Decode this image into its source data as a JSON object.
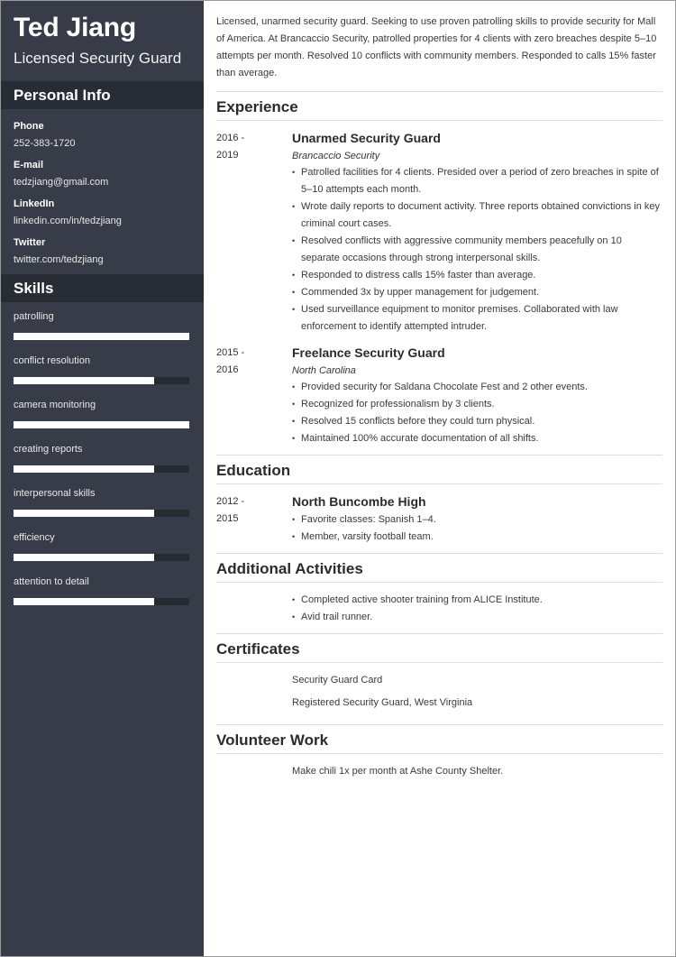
{
  "header": {
    "name": "Ted Jiang",
    "role": "Licensed Security Guard"
  },
  "personal_info": {
    "heading": "Personal Info",
    "items": [
      {
        "label": "Phone",
        "value": "252-383-1720"
      },
      {
        "label": "E-mail",
        "value": "tedzjiang@gmail.com"
      },
      {
        "label": "LinkedIn",
        "value": "linkedin.com/in/tedzjiang"
      },
      {
        "label": "Twitter",
        "value": "twitter.com/tedzjiang"
      }
    ]
  },
  "skills": {
    "heading": "Skills",
    "items": [
      {
        "label": "patrolling",
        "level": 1.0
      },
      {
        "label": "conflict resolution",
        "level": 0.8
      },
      {
        "label": "camera monitoring",
        "level": 1.0
      },
      {
        "label": "creating reports",
        "level": 0.8
      },
      {
        "label": "interpersonal skills",
        "level": 0.8
      },
      {
        "label": "efficiency",
        "level": 0.8
      },
      {
        "label": "attention to detail",
        "level": 0.8
      }
    ]
  },
  "summary": "Licensed, unarmed security guard. Seeking to use proven patrolling skills to provide security for Mall of America. At Brancaccio Security, patrolled properties for 4 clients with zero breaches despite 5–10 attempts per month. Resolved 10 conflicts with community members. Responded to calls 15% faster than average.",
  "experience": {
    "heading": "Experience",
    "entries": [
      {
        "date_start": "2016 -",
        "date_end": "2019",
        "title": "Unarmed Security Guard",
        "subtitle": "Brancaccio Security",
        "bullets": [
          "Patrolled facilities for 4 clients. Presided over a period of zero breaches in spite of 5–10 attempts each month.",
          "Wrote daily reports to document activity. Three reports obtained convictions in key criminal court cases.",
          "Resolved conflicts with aggressive community members peacefully on 10 separate occasions through strong interpersonal skills.",
          "Responded to distress calls 15% faster than average.",
          "Commended 3x by upper management for judgement.",
          "Used surveillance equipment to monitor premises. Collaborated with law enforcement to identify attempted intruder."
        ]
      },
      {
        "date_start": "2015 -",
        "date_end": "2016",
        "title": "Freelance Security Guard",
        "subtitle": "North Carolina",
        "bullets": [
          "Provided security for Saldana Chocolate Fest and 2 other events.",
          "Recognized for professionalism by 3 clients.",
          "Resolved 15 conflicts before they could turn physical.",
          "Maintained 100% accurate documentation of all shifts."
        ]
      }
    ]
  },
  "education": {
    "heading": "Education",
    "entries": [
      {
        "date_start": "2012 -",
        "date_end": "2015",
        "title": "North Buncombe High",
        "bullets": [
          "Favorite classes: Spanish 1–4.",
          "Member, varsity football team."
        ]
      }
    ]
  },
  "activities": {
    "heading": "Additional Activities",
    "bullets": [
      "Completed active shooter training from ALICE Institute.",
      "Avid trail runner."
    ]
  },
  "certificates": {
    "heading": "Certificates",
    "items": [
      "Security Guard Card",
      "Registered Security Guard, West Virginia"
    ]
  },
  "volunteer": {
    "heading": "Volunteer Work",
    "items": [
      "Make chili 1x per month at Ashe County Shelter."
    ]
  }
}
